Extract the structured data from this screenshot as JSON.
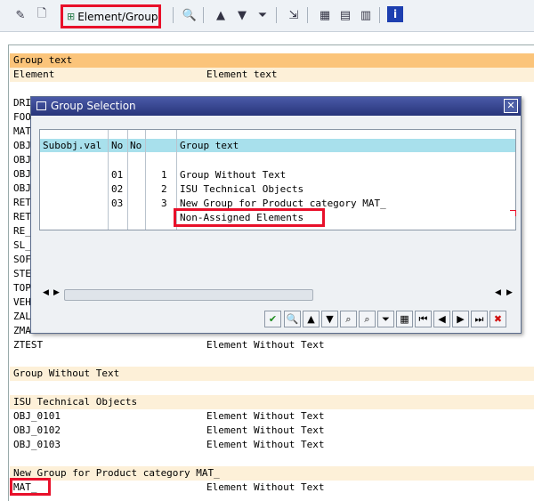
{
  "toolbar": {
    "element_group_label": "Element/Group"
  },
  "list": {
    "header_group": "Group text",
    "header_element": "Element",
    "header_element_text": "Element text",
    "left_items": [
      "DRI",
      "FOO",
      "MAT",
      "OBJ",
      "OBJ",
      "OBJ",
      "OBJ",
      "RET",
      "RET",
      "RE_",
      "SL_",
      "SOF",
      "STE",
      "TOP",
      "VEH",
      "ZAL",
      "ZMA"
    ],
    "ztest": {
      "name": "ZTEST",
      "text": "Element Without Text"
    },
    "group_without_text": "Group Without Text",
    "isu_group": "ISU Technical Objects",
    "isu_rows": [
      {
        "name": "OBJ_0101",
        "text": "Element Without Text"
      },
      {
        "name": "OBJ_0102",
        "text": "Element Without Text"
      },
      {
        "name": "OBJ_0103",
        "text": "Element Without Text"
      }
    ],
    "new_group": "New Group for Product category MAT_",
    "mat_row": {
      "name": "MAT_",
      "text": "Element Without Text"
    }
  },
  "popup": {
    "title": "Group Selection",
    "columns": {
      "subobj": "Subobj.val",
      "no1": "No",
      "no2": "No",
      "group_text": "Group text"
    },
    "rows": [
      {
        "no1": "01",
        "no2": "1",
        "text": "Group Without Text"
      },
      {
        "no1": "02",
        "no2": "2",
        "text": "ISU Technical Objects"
      },
      {
        "no1": "03",
        "no2": "3",
        "text": "New Group for Product category MAT_"
      },
      {
        "no1": "",
        "no2": "",
        "text": "Non-Assigned Elements"
      }
    ]
  },
  "colors": {
    "orange_band": "#fbc47a",
    "light_band": "#fdf0d8",
    "header_cyan": "#a8e0ec",
    "highlight_red": "#e8102a"
  }
}
